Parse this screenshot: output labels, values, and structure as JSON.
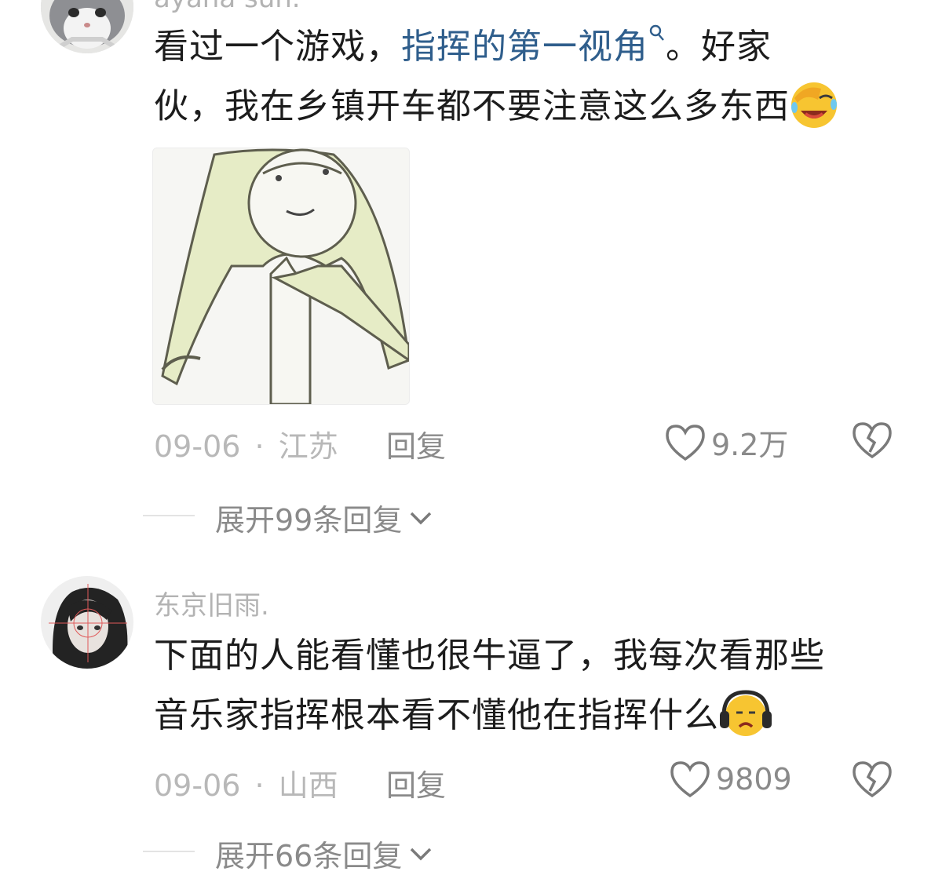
{
  "comments": [
    {
      "username": "ayana sun.",
      "text_part1": "看过一个游戏，",
      "hashtag": "指挥的第一视角",
      "text_part2": "。好家",
      "text_line2": "伙，我在乡镇开车都不要注意这么多东西",
      "emoji": "facepalm-laugh-emoji",
      "date": "09-06",
      "location": "江苏",
      "reply_label": "回复",
      "likes": "9.2万",
      "expand_label": "展开99条回复"
    },
    {
      "username": "东京旧雨.",
      "text_line1": "下面的人能看懂也很牛逼了，我每次看那些",
      "text_line2": "音乐家指挥根本看不懂他在指挥什么",
      "emoji": "headphones-sad-emoji",
      "date": "09-06",
      "location": "山西",
      "reply_label": "回复",
      "likes": "9809",
      "expand_label": "展开66条回复"
    }
  ],
  "separator": "·",
  "colors": {
    "hashtag": "#2f5e8c",
    "meta": "#b8b8b8",
    "action": "#8a8a8a"
  }
}
